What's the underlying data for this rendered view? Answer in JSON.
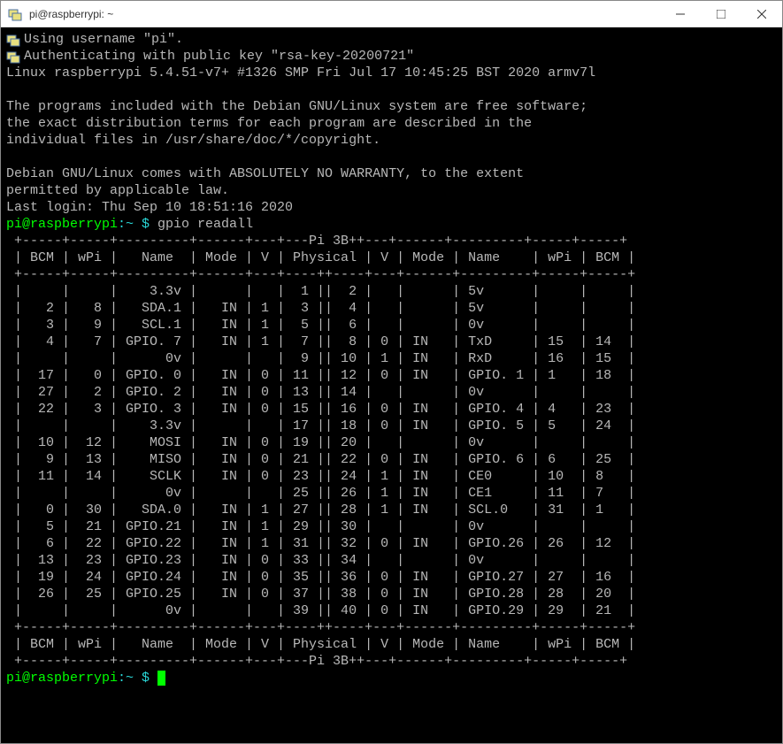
{
  "window": {
    "title": "pi@raspberrypi: ~"
  },
  "motd": [
    "Using username \"pi\".",
    "Authenticating with public key \"rsa-key-20200721\"",
    "Linux raspberrypi 5.4.51-v7+ #1326 SMP Fri Jul 17 10:45:25 BST 2020 armv7l",
    "",
    "The programs included with the Debian GNU/Linux system are free software;",
    "the exact distribution terms for each program are described in the",
    "individual files in /usr/share/doc/*/copyright.",
    "",
    "Debian GNU/Linux comes with ABSOLUTELY NO WARRANTY, to the extent",
    "permitted by applicable law.",
    "Last login: Thu Sep 10 18:51:16 2020"
  ],
  "prompt": {
    "user_host": "pi@raspberrypi",
    "cwd": ":~ $",
    "command": "gpio readall",
    "empty_command": ""
  },
  "table": {
    "model": "Pi 3B+",
    "headers": {
      "bcm": "BCM",
      "wpi": "wPi",
      "name": "Name",
      "mode": "Mode",
      "v": "V",
      "physical": "Physical"
    },
    "rows": [
      {
        "l": {
          "bcm": "",
          "wpi": "",
          "name": "3.3v",
          "mode": "",
          "v": "",
          "phys": "1"
        },
        "r": {
          "phys": "2",
          "v": "",
          "mode": "",
          "name": "5v",
          "wpi": "",
          "bcm": ""
        }
      },
      {
        "l": {
          "bcm": "2",
          "wpi": "8",
          "name": "SDA.1",
          "mode": "IN",
          "v": "1",
          "phys": "3"
        },
        "r": {
          "phys": "4",
          "v": "",
          "mode": "",
          "name": "5v",
          "wpi": "",
          "bcm": ""
        }
      },
      {
        "l": {
          "bcm": "3",
          "wpi": "9",
          "name": "SCL.1",
          "mode": "IN",
          "v": "1",
          "phys": "5"
        },
        "r": {
          "phys": "6",
          "v": "",
          "mode": "",
          "name": "0v",
          "wpi": "",
          "bcm": ""
        }
      },
      {
        "l": {
          "bcm": "4",
          "wpi": "7",
          "name": "GPIO. 7",
          "mode": "IN",
          "v": "1",
          "phys": "7"
        },
        "r": {
          "phys": "8",
          "v": "0",
          "mode": "IN",
          "name": "TxD",
          "wpi": "15",
          "bcm": "14"
        }
      },
      {
        "l": {
          "bcm": "",
          "wpi": "",
          "name": "0v",
          "mode": "",
          "v": "",
          "phys": "9"
        },
        "r": {
          "phys": "10",
          "v": "1",
          "mode": "IN",
          "name": "RxD",
          "wpi": "16",
          "bcm": "15"
        }
      },
      {
        "l": {
          "bcm": "17",
          "wpi": "0",
          "name": "GPIO. 0",
          "mode": "IN",
          "v": "0",
          "phys": "11"
        },
        "r": {
          "phys": "12",
          "v": "0",
          "mode": "IN",
          "name": "GPIO. 1",
          "wpi": "1",
          "bcm": "18"
        }
      },
      {
        "l": {
          "bcm": "27",
          "wpi": "2",
          "name": "GPIO. 2",
          "mode": "IN",
          "v": "0",
          "phys": "13"
        },
        "r": {
          "phys": "14",
          "v": "",
          "mode": "",
          "name": "0v",
          "wpi": "",
          "bcm": ""
        }
      },
      {
        "l": {
          "bcm": "22",
          "wpi": "3",
          "name": "GPIO. 3",
          "mode": "IN",
          "v": "0",
          "phys": "15"
        },
        "r": {
          "phys": "16",
          "v": "0",
          "mode": "IN",
          "name": "GPIO. 4",
          "wpi": "4",
          "bcm": "23"
        }
      },
      {
        "l": {
          "bcm": "",
          "wpi": "",
          "name": "3.3v",
          "mode": "",
          "v": "",
          "phys": "17"
        },
        "r": {
          "phys": "18",
          "v": "0",
          "mode": "IN",
          "name": "GPIO. 5",
          "wpi": "5",
          "bcm": "24"
        }
      },
      {
        "l": {
          "bcm": "10",
          "wpi": "12",
          "name": "MOSI",
          "mode": "IN",
          "v": "0",
          "phys": "19"
        },
        "r": {
          "phys": "20",
          "v": "",
          "mode": "",
          "name": "0v",
          "wpi": "",
          "bcm": ""
        }
      },
      {
        "l": {
          "bcm": "9",
          "wpi": "13",
          "name": "MISO",
          "mode": "IN",
          "v": "0",
          "phys": "21"
        },
        "r": {
          "phys": "22",
          "v": "0",
          "mode": "IN",
          "name": "GPIO. 6",
          "wpi": "6",
          "bcm": "25"
        }
      },
      {
        "l": {
          "bcm": "11",
          "wpi": "14",
          "name": "SCLK",
          "mode": "IN",
          "v": "0",
          "phys": "23"
        },
        "r": {
          "phys": "24",
          "v": "1",
          "mode": "IN",
          "name": "CE0",
          "wpi": "10",
          "bcm": "8"
        }
      },
      {
        "l": {
          "bcm": "",
          "wpi": "",
          "name": "0v",
          "mode": "",
          "v": "",
          "phys": "25"
        },
        "r": {
          "phys": "26",
          "v": "1",
          "mode": "IN",
          "name": "CE1",
          "wpi": "11",
          "bcm": "7"
        }
      },
      {
        "l": {
          "bcm": "0",
          "wpi": "30",
          "name": "SDA.0",
          "mode": "IN",
          "v": "1",
          "phys": "27"
        },
        "r": {
          "phys": "28",
          "v": "1",
          "mode": "IN",
          "name": "SCL.0",
          "wpi": "31",
          "bcm": "1"
        }
      },
      {
        "l": {
          "bcm": "5",
          "wpi": "21",
          "name": "GPIO.21",
          "mode": "IN",
          "v": "1",
          "phys": "29"
        },
        "r": {
          "phys": "30",
          "v": "",
          "mode": "",
          "name": "0v",
          "wpi": "",
          "bcm": ""
        }
      },
      {
        "l": {
          "bcm": "6",
          "wpi": "22",
          "name": "GPIO.22",
          "mode": "IN",
          "v": "1",
          "phys": "31"
        },
        "r": {
          "phys": "32",
          "v": "0",
          "mode": "IN",
          "name": "GPIO.26",
          "wpi": "26",
          "bcm": "12"
        }
      },
      {
        "l": {
          "bcm": "13",
          "wpi": "23",
          "name": "GPIO.23",
          "mode": "IN",
          "v": "0",
          "phys": "33"
        },
        "r": {
          "phys": "34",
          "v": "",
          "mode": "",
          "name": "0v",
          "wpi": "",
          "bcm": ""
        }
      },
      {
        "l": {
          "bcm": "19",
          "wpi": "24",
          "name": "GPIO.24",
          "mode": "IN",
          "v": "0",
          "phys": "35"
        },
        "r": {
          "phys": "36",
          "v": "0",
          "mode": "IN",
          "name": "GPIO.27",
          "wpi": "27",
          "bcm": "16"
        }
      },
      {
        "l": {
          "bcm": "26",
          "wpi": "25",
          "name": "GPIO.25",
          "mode": "IN",
          "v": "0",
          "phys": "37"
        },
        "r": {
          "phys": "38",
          "v": "0",
          "mode": "IN",
          "name": "GPIO.28",
          "wpi": "28",
          "bcm": "20"
        }
      },
      {
        "l": {
          "bcm": "",
          "wpi": "",
          "name": "0v",
          "mode": "",
          "v": "",
          "phys": "39"
        },
        "r": {
          "phys": "40",
          "v": "0",
          "mode": "IN",
          "name": "GPIO.29",
          "wpi": "29",
          "bcm": "21"
        }
      }
    ]
  },
  "chart_data": {
    "type": "table",
    "title": "gpio readall — Pi 3B+",
    "columns_left": [
      "BCM",
      "wPi",
      "Name",
      "Mode",
      "V",
      "Physical"
    ],
    "columns_right": [
      "Physical",
      "V",
      "Mode",
      "Name",
      "wPi",
      "BCM"
    ],
    "rows": [
      [
        "",
        "",
        "3.3v",
        "",
        "",
        "1",
        "2",
        "",
        "",
        "5v",
        "",
        ""
      ],
      [
        "2",
        "8",
        "SDA.1",
        "IN",
        "1",
        "3",
        "4",
        "",
        "",
        "5v",
        "",
        ""
      ],
      [
        "3",
        "9",
        "SCL.1",
        "IN",
        "1",
        "5",
        "6",
        "",
        "",
        "0v",
        "",
        ""
      ],
      [
        "4",
        "7",
        "GPIO. 7",
        "IN",
        "1",
        "7",
        "8",
        "0",
        "IN",
        "TxD",
        "15",
        "14"
      ],
      [
        "",
        "",
        "0v",
        "",
        "",
        "9",
        "10",
        "1",
        "IN",
        "RxD",
        "16",
        "15"
      ],
      [
        "17",
        "0",
        "GPIO. 0",
        "IN",
        "0",
        "11",
        "12",
        "0",
        "IN",
        "GPIO. 1",
        "1",
        "18"
      ],
      [
        "27",
        "2",
        "GPIO. 2",
        "IN",
        "0",
        "13",
        "14",
        "",
        "",
        "0v",
        "",
        ""
      ],
      [
        "22",
        "3",
        "GPIO. 3",
        "IN",
        "0",
        "15",
        "16",
        "0",
        "IN",
        "GPIO. 4",
        "4",
        "23"
      ],
      [
        "",
        "",
        "3.3v",
        "",
        "",
        "17",
        "18",
        "0",
        "IN",
        "GPIO. 5",
        "5",
        "24"
      ],
      [
        "10",
        "12",
        "MOSI",
        "IN",
        "0",
        "19",
        "20",
        "",
        "",
        "0v",
        "",
        ""
      ],
      [
        "9",
        "13",
        "MISO",
        "IN",
        "0",
        "21",
        "22",
        "0",
        "IN",
        "GPIO. 6",
        "6",
        "25"
      ],
      [
        "11",
        "14",
        "SCLK",
        "IN",
        "0",
        "23",
        "24",
        "1",
        "IN",
        "CE0",
        "10",
        "8"
      ],
      [
        "",
        "",
        "0v",
        "",
        "",
        "25",
        "26",
        "1",
        "IN",
        "CE1",
        "11",
        "7"
      ],
      [
        "0",
        "30",
        "SDA.0",
        "IN",
        "1",
        "27",
        "28",
        "1",
        "IN",
        "SCL.0",
        "31",
        "1"
      ],
      [
        "5",
        "21",
        "GPIO.21",
        "IN",
        "1",
        "29",
        "30",
        "",
        "",
        "0v",
        "",
        ""
      ],
      [
        "6",
        "22",
        "GPIO.22",
        "IN",
        "1",
        "31",
        "32",
        "0",
        "IN",
        "GPIO.26",
        "26",
        "12"
      ],
      [
        "13",
        "23",
        "GPIO.23",
        "IN",
        "0",
        "33",
        "34",
        "",
        "",
        "0v",
        "",
        ""
      ],
      [
        "19",
        "24",
        "GPIO.24",
        "IN",
        "0",
        "35",
        "36",
        "0",
        "IN",
        "GPIO.27",
        "27",
        "16"
      ],
      [
        "26",
        "25",
        "GPIO.25",
        "IN",
        "0",
        "37",
        "38",
        "0",
        "IN",
        "GPIO.28",
        "28",
        "20"
      ],
      [
        "",
        "",
        "0v",
        "",
        "",
        "39",
        "40",
        "0",
        "IN",
        "GPIO.29",
        "29",
        "21"
      ]
    ]
  }
}
